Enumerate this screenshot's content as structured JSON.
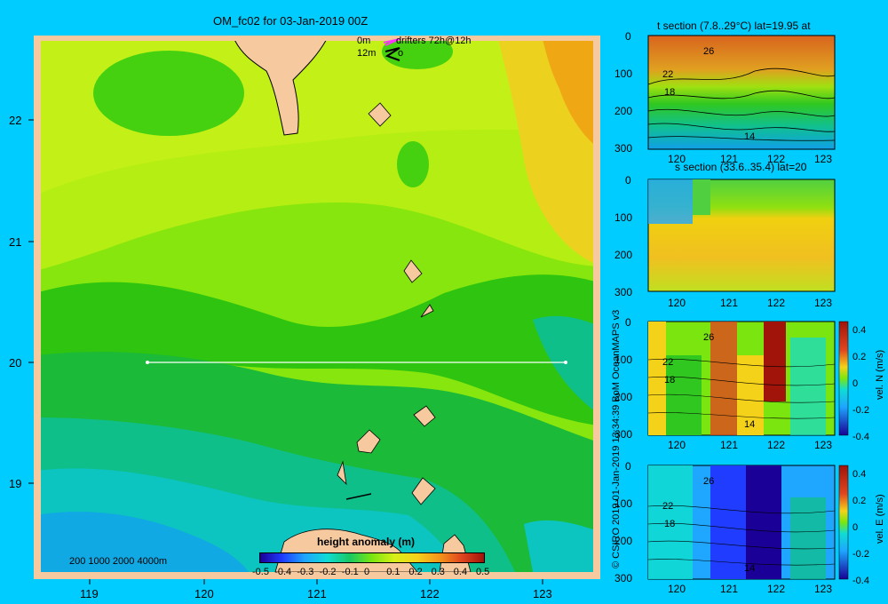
{
  "main_map": {
    "title": "OM_fc02 for 03-Jan-2019 00Z",
    "legend": {
      "drifter_text": "drifters 72h@12h",
      "depth_0": "0m",
      "depth_12": "12m",
      "depth_12_suffix": "o",
      "depth_0_color": "#ff33ff",
      "depth_12_color": "#000000"
    },
    "x_ticks": [
      "119",
      "120",
      "121",
      "122",
      "123"
    ],
    "y_ticks": [
      "22",
      "21",
      "20",
      "19"
    ],
    "bathy_label": "200  1000  2000  4000m",
    "colorbar": {
      "title": "height anomaly (m)",
      "tick_labels": [
        "-0.5",
        "-0.4",
        "-0.3",
        "-0.2",
        "-0.1",
        "0",
        "0.1",
        "0.2",
        "0.3",
        "0.4",
        "0.5"
      ],
      "range": [
        -0.5,
        0.5
      ]
    }
  },
  "chart_data": [
    {
      "type": "heatmap",
      "title": "OM_fc02 for 03-Jan-2019 00Z",
      "x": [
        119,
        120,
        121,
        122,
        123
      ],
      "y": [
        19,
        20,
        21,
        22
      ],
      "xlim": [
        118.5,
        123.5
      ],
      "ylim": [
        18.25,
        22.7
      ],
      "colorbar_label": "height anomaly (m)",
      "colorbar_range": [
        -0.5,
        0.5
      ],
      "section_line": {
        "lat": 20,
        "lon_start": 119.5,
        "lon_end": 123.2
      }
    },
    {
      "type": "heatmap",
      "title": "t section (7.8..29°C) lat=19.95 at",
      "x_ticks": [
        120,
        121,
        122,
        123
      ],
      "y_ticks": [
        0,
        100,
        200,
        300
      ],
      "contour_labels": [
        "26",
        "22",
        "18",
        "14"
      ]
    },
    {
      "type": "heatmap",
      "title": "s section (33.6..35.4) lat=20",
      "x_ticks": [
        120,
        121,
        122,
        123
      ],
      "y_ticks": [
        0,
        100,
        200,
        300
      ]
    },
    {
      "type": "heatmap",
      "title": "",
      "x_ticks": [
        120,
        121,
        122,
        123
      ],
      "y_ticks": [
        0,
        100,
        200,
        300
      ],
      "colorbar_label": "vel. N (m/s)",
      "colorbar_ticks": [
        "0.4",
        "0.2",
        "0",
        "-0.2",
        "-0.4"
      ],
      "contour_labels": [
        "26",
        "22",
        "18",
        "14"
      ]
    },
    {
      "type": "heatmap",
      "title": "",
      "x_ticks": [
        120,
        121,
        122,
        123
      ],
      "y_ticks": [
        0,
        100,
        200,
        300
      ],
      "colorbar_label": "vel. E (m/s)",
      "colorbar_ticks": [
        "0.4",
        "0.2",
        "0",
        "-0.2",
        "-0.4"
      ],
      "contour_labels": [
        "26",
        "22",
        "18",
        "14"
      ]
    }
  ],
  "side_panels": {
    "t_title": "t section (7.8..29°C) lat=19.95 at",
    "s_title": "s section (33.6..35.4) lat=20",
    "x_ticks": [
      "120",
      "121",
      "122",
      "123"
    ],
    "y_ticks": [
      "0",
      "100",
      "200",
      "300"
    ],
    "t_contours": [
      "26",
      "22",
      "18",
      "14"
    ],
    "vn_label": "vel. N (m/s)",
    "ve_label": "vel. E (m/s)",
    "vel_ticks": [
      "0.4",
      "0.2",
      "0",
      "-0.2",
      "-0.4"
    ]
  },
  "credit": "© CSIRO 2019   01-Jan-2019 13:34:39 BoM OceanMAPS v3"
}
